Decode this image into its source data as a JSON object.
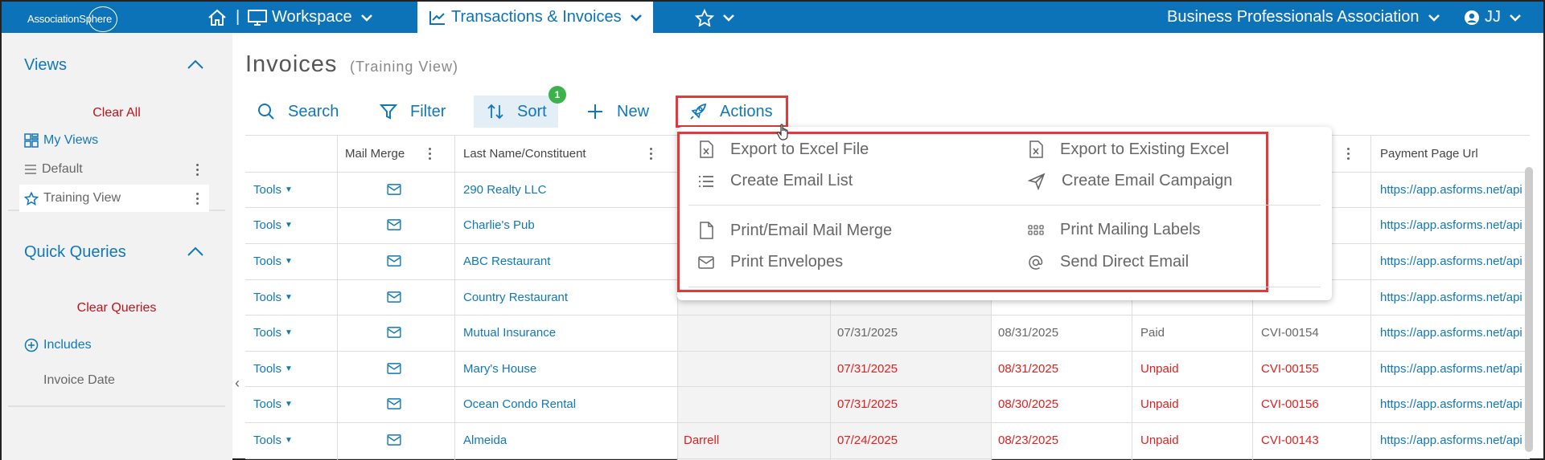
{
  "brand": {
    "logo_text": "AssociationSphere"
  },
  "nav": {
    "separator": "|",
    "workspace": "Workspace",
    "transactions": "Transactions & Invoices",
    "organization": "Business Professionals Association",
    "user_initials": "JJ"
  },
  "sidebar": {
    "views_title": "Views",
    "clear_all": "Clear All",
    "my_views": "My Views",
    "default": "Default",
    "training_view": "Training View",
    "quick_queries_title": "Quick Queries",
    "clear_queries": "Clear Queries",
    "includes": "Includes",
    "invoice_date": "Invoice Date"
  },
  "page": {
    "title": "Invoices",
    "subtitle": "(Training View)"
  },
  "toolbar": {
    "search": "Search",
    "filter": "Filter",
    "sort": "Sort",
    "sort_badge": "1",
    "new": "New",
    "actions": "Actions"
  },
  "table": {
    "headers": {
      "mail_merge": "Mail Merge",
      "last_name": "Last Name/Constituent",
      "payment_url": "Payment Page Url"
    },
    "tools_label": "Tools",
    "rows": [
      {
        "name": "290 Realty LLC",
        "contact": "",
        "invoice_date": "",
        "due_date": "",
        "status": "",
        "invoice_no": "",
        "url": "https://app.asforms.net/api",
        "color": "normal"
      },
      {
        "name": "Charlie's Pub",
        "contact": "",
        "invoice_date": "",
        "due_date": "",
        "status": "",
        "invoice_no": "",
        "url": "https://app.asforms.net/api",
        "color": "normal"
      },
      {
        "name": "ABC Restaurant",
        "contact": "",
        "invoice_date": "",
        "due_date": "",
        "status": "",
        "invoice_no": "",
        "url": "https://app.asforms.net/api",
        "color": "normal"
      },
      {
        "name": "Country Restaurant",
        "contact": "",
        "invoice_date": "",
        "due_date": "",
        "status": "",
        "invoice_no": "",
        "url": "https://app.asforms.net/api",
        "color": "normal"
      },
      {
        "name": "Mutual Insurance",
        "contact": "",
        "invoice_date": "07/31/2025",
        "due_date": "08/31/2025",
        "status": "Paid",
        "invoice_no": "CVI-00154",
        "url": "https://app.asforms.net/api",
        "color": "gray"
      },
      {
        "name": "Mary's House",
        "contact": "",
        "invoice_date": "07/31/2025",
        "due_date": "08/31/2025",
        "status": "Unpaid",
        "invoice_no": "CVI-00155",
        "url": "https://app.asforms.net/api",
        "color": "red"
      },
      {
        "name": "Ocean Condo Rental",
        "contact": "",
        "invoice_date": "07/31/2025",
        "due_date": "08/30/2025",
        "status": "Unpaid",
        "invoice_no": "CVI-00156",
        "url": "https://app.asforms.net/api",
        "color": "red"
      },
      {
        "name": "Almeida",
        "contact": "Darrell",
        "invoice_date": "07/24/2025",
        "due_date": "08/23/2025",
        "status": "Unpaid",
        "invoice_no": "CVI-00143",
        "url": "https://app.asforms.net/api",
        "color": "red"
      }
    ]
  },
  "actions_menu": {
    "export_excel": "Export to Excel File",
    "export_existing": "Export to Existing Excel",
    "create_email_list": "Create Email List",
    "create_campaign": "Create Email Campaign",
    "print_mail_merge": "Print/Email Mail Merge",
    "print_labels": "Print Mailing Labels",
    "print_envelopes": "Print Envelopes",
    "send_direct_email": "Send Direct Email"
  },
  "colors": {
    "primary": "#0d73b8",
    "accent_red": "#e03a3a",
    "unpaid_red": "#e02020",
    "badge_green": "#3cb34a"
  }
}
